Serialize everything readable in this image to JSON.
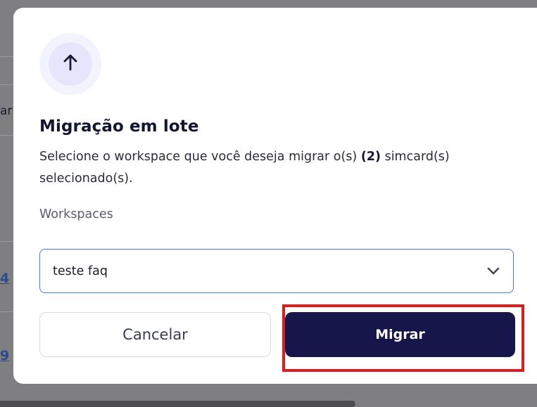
{
  "background": {
    "partial_texts": [
      "ar"
    ],
    "partial_links": [
      "4",
      "9"
    ]
  },
  "modal": {
    "icon": "arrow-up-icon",
    "title": "Migração em lote",
    "description_before": "Selecione o workspace que você deseja migrar o(s) ",
    "description_count": "(2)",
    "description_after": " simcard(s) selecionado(s).",
    "workspaces_label": "Workspaces",
    "workspace_select": {
      "selected": "teste faq"
    },
    "cancel_label": "Cancelar",
    "migrate_label": "Migrar"
  },
  "colors": {
    "primary": "#16164a",
    "select_border": "#4a78d6",
    "highlight": "#e01b1b",
    "icon_bg": "#e5e6fb"
  }
}
